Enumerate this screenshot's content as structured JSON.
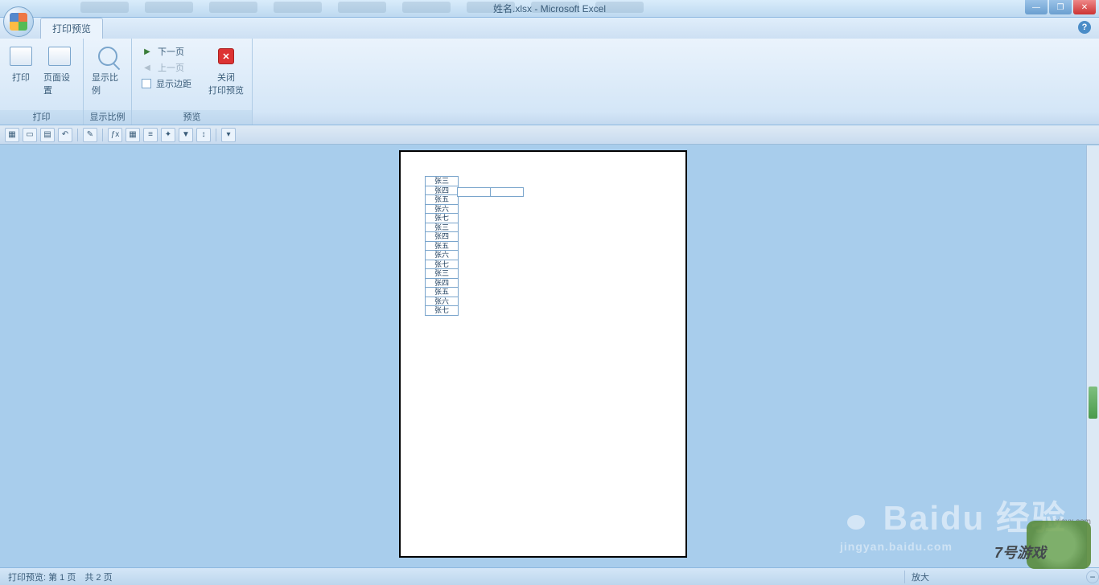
{
  "title": "姓名.xlsx - Microsoft Excel",
  "tab": {
    "label": "打印预览"
  },
  "ribbon": {
    "print_group": {
      "label": "打印",
      "print_btn": "打印",
      "page_setup_btn": "页面设置"
    },
    "zoom_group": {
      "label": "显示比例",
      "zoom_btn": "显示比例"
    },
    "nav_group": {
      "next_page": "下一页",
      "prev_page": "上一页",
      "show_margins": "显示边距"
    },
    "close_group": {
      "label": "预览",
      "close_line1": "关闭",
      "close_line2": "打印预览"
    }
  },
  "help_tooltip": "?",
  "window_controls": {
    "min": "—",
    "max": "❐",
    "close": "✕"
  },
  "table_rows": [
    "张三",
    "张四",
    "张五",
    "张六",
    "张七",
    "张三",
    "张四",
    "张五",
    "张六",
    "张七",
    "张三",
    "张四",
    "张五",
    "张六",
    "张七"
  ],
  "statusbar": {
    "left": "打印预览: 第 1 页　共 2 页",
    "right": "放大"
  },
  "watermarks": {
    "baidu": "Baidu 经验",
    "baidu_sub": "jingyan.baidu.com",
    "game_text": "7号游戏",
    "game_url": "xiayx.com"
  }
}
